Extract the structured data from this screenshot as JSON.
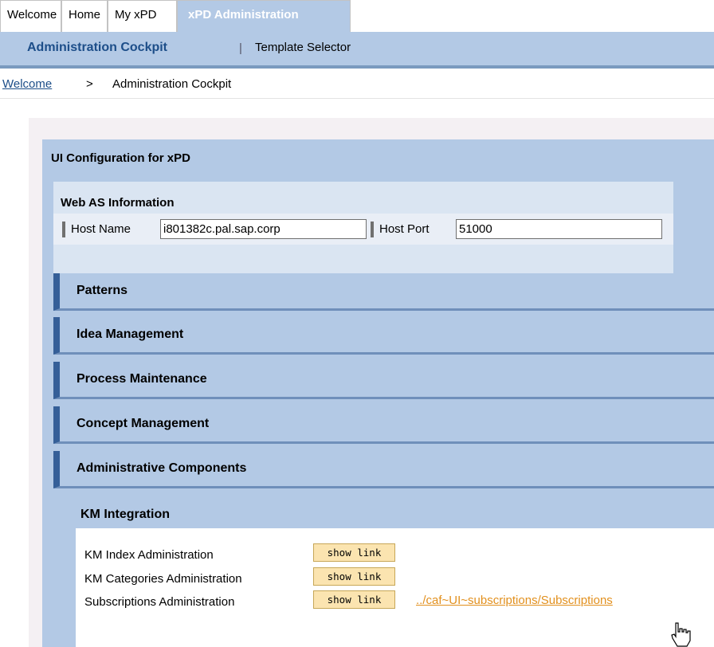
{
  "tabs": [
    {
      "label": "Welcome"
    },
    {
      "label": "Home"
    },
    {
      "label": "My xPD"
    },
    {
      "label": "xPD Administration"
    }
  ],
  "subnav": {
    "item1": "Administration Cockpit",
    "separator": "|",
    "item2": "Template Selector"
  },
  "breadcrumb": {
    "link": "Welcome",
    "separator": ">",
    "current": "Administration Cockpit"
  },
  "ui_config": {
    "title": "UI Configuration for xPD"
  },
  "webas": {
    "title": "Web AS Information",
    "host_name_label": "Host Name",
    "host_name_value": "i801382c.pal.sap.corp",
    "host_port_label": "Host Port",
    "host_port_value": "51000"
  },
  "sections": [
    {
      "title": "Patterns"
    },
    {
      "title": "Idea Management"
    },
    {
      "title": "Process Maintenance"
    },
    {
      "title": "Concept Management"
    },
    {
      "title": "Administrative Components"
    }
  ],
  "km": {
    "title": "KM Integration",
    "rows": [
      {
        "label": "KM Index Administration",
        "button": "show link"
      },
      {
        "label": "KM Categories Administration",
        "button": "show link"
      },
      {
        "label": "Subscriptions Administration",
        "button": "show link",
        "link": "../caf~UI~subscriptions/Subscriptions"
      }
    ]
  },
  "icons": {
    "cursor": "hand-cursor-icon"
  },
  "colors": {
    "header_blue": "#b3c9e5",
    "accent_dark_blue": "#355f98",
    "button_bg": "#fbe4b0",
    "link_orange": "#e2901e"
  }
}
